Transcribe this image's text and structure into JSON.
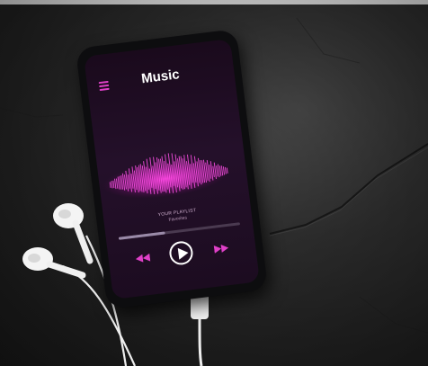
{
  "screen": {
    "title": "Music",
    "playlist_label": "YOUR PLAYLIST",
    "playlist_name": "Favorites",
    "progress": 0.38,
    "accent_color": "#e040c8"
  },
  "icons": {
    "menu": "hamburger-menu-icon",
    "prev": "rewind-icon",
    "play": "play-icon",
    "next": "fast-forward-icon"
  }
}
